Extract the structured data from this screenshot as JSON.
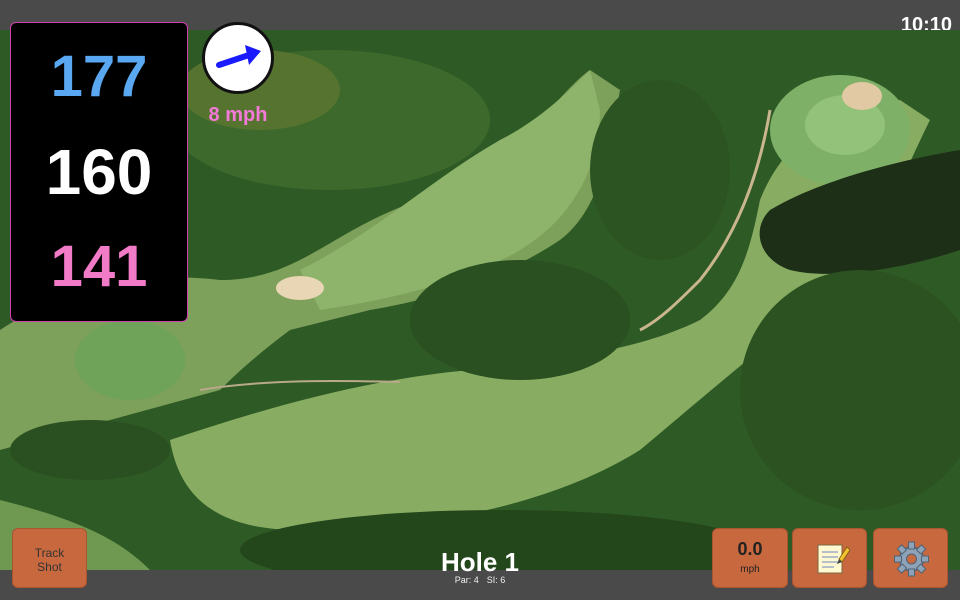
{
  "clock": "10:10",
  "yardage": {
    "back": "177",
    "middle": "160",
    "front": "141"
  },
  "wind": {
    "speed": "8 mph",
    "icon": "wind-arrow-icon",
    "color": "#1a1aff"
  },
  "bottom": {
    "track_label_line1": "Track",
    "track_label_line2": "Shot",
    "speed_value": "0.0",
    "speed_unit": "mph",
    "notes_icon": "notepad-icon",
    "settings_icon": "gear-icon"
  },
  "hole": {
    "title": "Hole 1",
    "par": "Par: 4",
    "si": "SI: 6"
  },
  "colors": {
    "back": "#5aa7f2",
    "middle": "#ffffff",
    "front": "#f27bc7",
    "accent": "#c8683e"
  }
}
